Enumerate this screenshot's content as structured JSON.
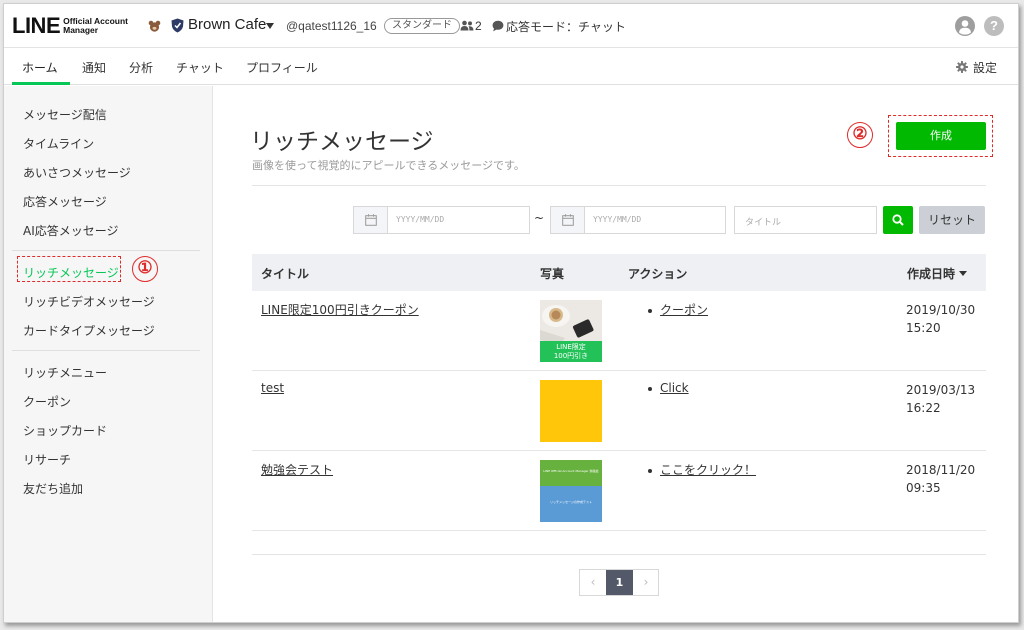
{
  "header": {
    "logo_main": "LINE",
    "logo_sub_line1": "Official Account",
    "logo_sub_line2": "Manager",
    "account_name": "Brown Cafe",
    "account_id": "@qatest1126_16",
    "plan_badge": "スタンダード",
    "friends_count": "2",
    "response_mode": "応答モード：チャット"
  },
  "tabs": [
    {
      "label": "ホーム",
      "active": true
    },
    {
      "label": "通知"
    },
    {
      "label": "分析"
    },
    {
      "label": "チャット"
    },
    {
      "label": "プロフィール"
    }
  ],
  "settings_label": "設定",
  "sidebar": {
    "group1": [
      "メッセージ配信",
      "タイムライン",
      "あいさつメッセージ",
      "応答メッセージ",
      "AI応答メッセージ"
    ],
    "group2": [
      "リッチメッセージ",
      "リッチビデオメッセージ",
      "カードタイプメッセージ"
    ],
    "group3": [
      "リッチメニュー",
      "クーポン",
      "ショップカード",
      "リサーチ",
      "友だち追加"
    ],
    "active_item": "リッチメッセージ"
  },
  "annotations": {
    "one": "①",
    "two": "②"
  },
  "main": {
    "title": "リッチメッセージ",
    "description": "画像を使って視覚的にアピールできるメッセージです。",
    "create_label": "作成"
  },
  "filters": {
    "date_placeholder": "YYYY/MM/DD",
    "tilde": "~",
    "title_placeholder": "タイトル",
    "reset_label": "リセット"
  },
  "table": {
    "columns": [
      "タイトル",
      "写真",
      "アクション",
      "作成日時"
    ],
    "rows": [
      {
        "title": "LINE限定100円引きクーポン",
        "thumb_caption1": "LINE限定",
        "thumb_caption2": "100円引き",
        "action": "クーポン",
        "date": "2019/10/30",
        "time": "15:20"
      },
      {
        "title": "test",
        "action": "Click",
        "date": "2019/03/13",
        "time": "16:22"
      },
      {
        "title": "勉強会テスト",
        "thumb_text_top": "LINE Official Account Manager 勉強会",
        "thumb_text_bottom": "リッチメッセージの作成テスト",
        "action": "ここをクリック！",
        "date": "2018/11/20",
        "time": "09:35"
      }
    ]
  },
  "pagination": {
    "prev": "‹",
    "current": "1",
    "next": "›"
  },
  "colors": {
    "accent": "#06c755",
    "button_green": "#00b900",
    "annotation_red": "#e02b2b",
    "thumb_yellow": "#ffc60a",
    "thumb_green": "#67b13f",
    "thumb_blue": "#5b9bd5"
  },
  "icons": [
    "bear-icon",
    "shield-icon",
    "caret-icon",
    "people-icon",
    "bubble-icon",
    "user-icon",
    "help-icon",
    "gear-icon",
    "calendar-icon",
    "search-icon",
    "sort-icon"
  ]
}
